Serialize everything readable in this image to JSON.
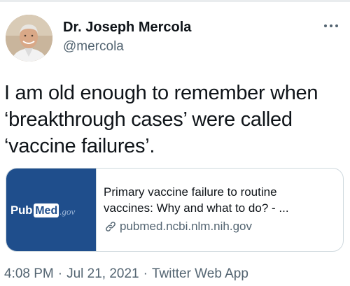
{
  "author": {
    "name": "Dr. Joseph Mercola",
    "handle": "@mercola"
  },
  "tweet": {
    "lines": [
      "I am old enough to remember when",
      "‘breakthrough cases’ were called",
      "‘vaccine failures’."
    ]
  },
  "link_card": {
    "thumbnail": {
      "logo_pub": "Pub",
      "logo_med": "Med",
      "logo_gov": ".gov",
      "background": "#1f4e8c"
    },
    "title_lines": [
      "Primary vaccine failure to routine",
      "vaccines: Why and what to do? - ..."
    ],
    "domain": "pubmed.ncbi.nlm.nih.gov",
    "domain_icon": "link-icon"
  },
  "meta": {
    "time": "4:08 PM",
    "date": "Jul 21, 2021",
    "source": "Twitter Web App",
    "separator": "·"
  },
  "header": {
    "more_icon": "more-dots-icon"
  }
}
